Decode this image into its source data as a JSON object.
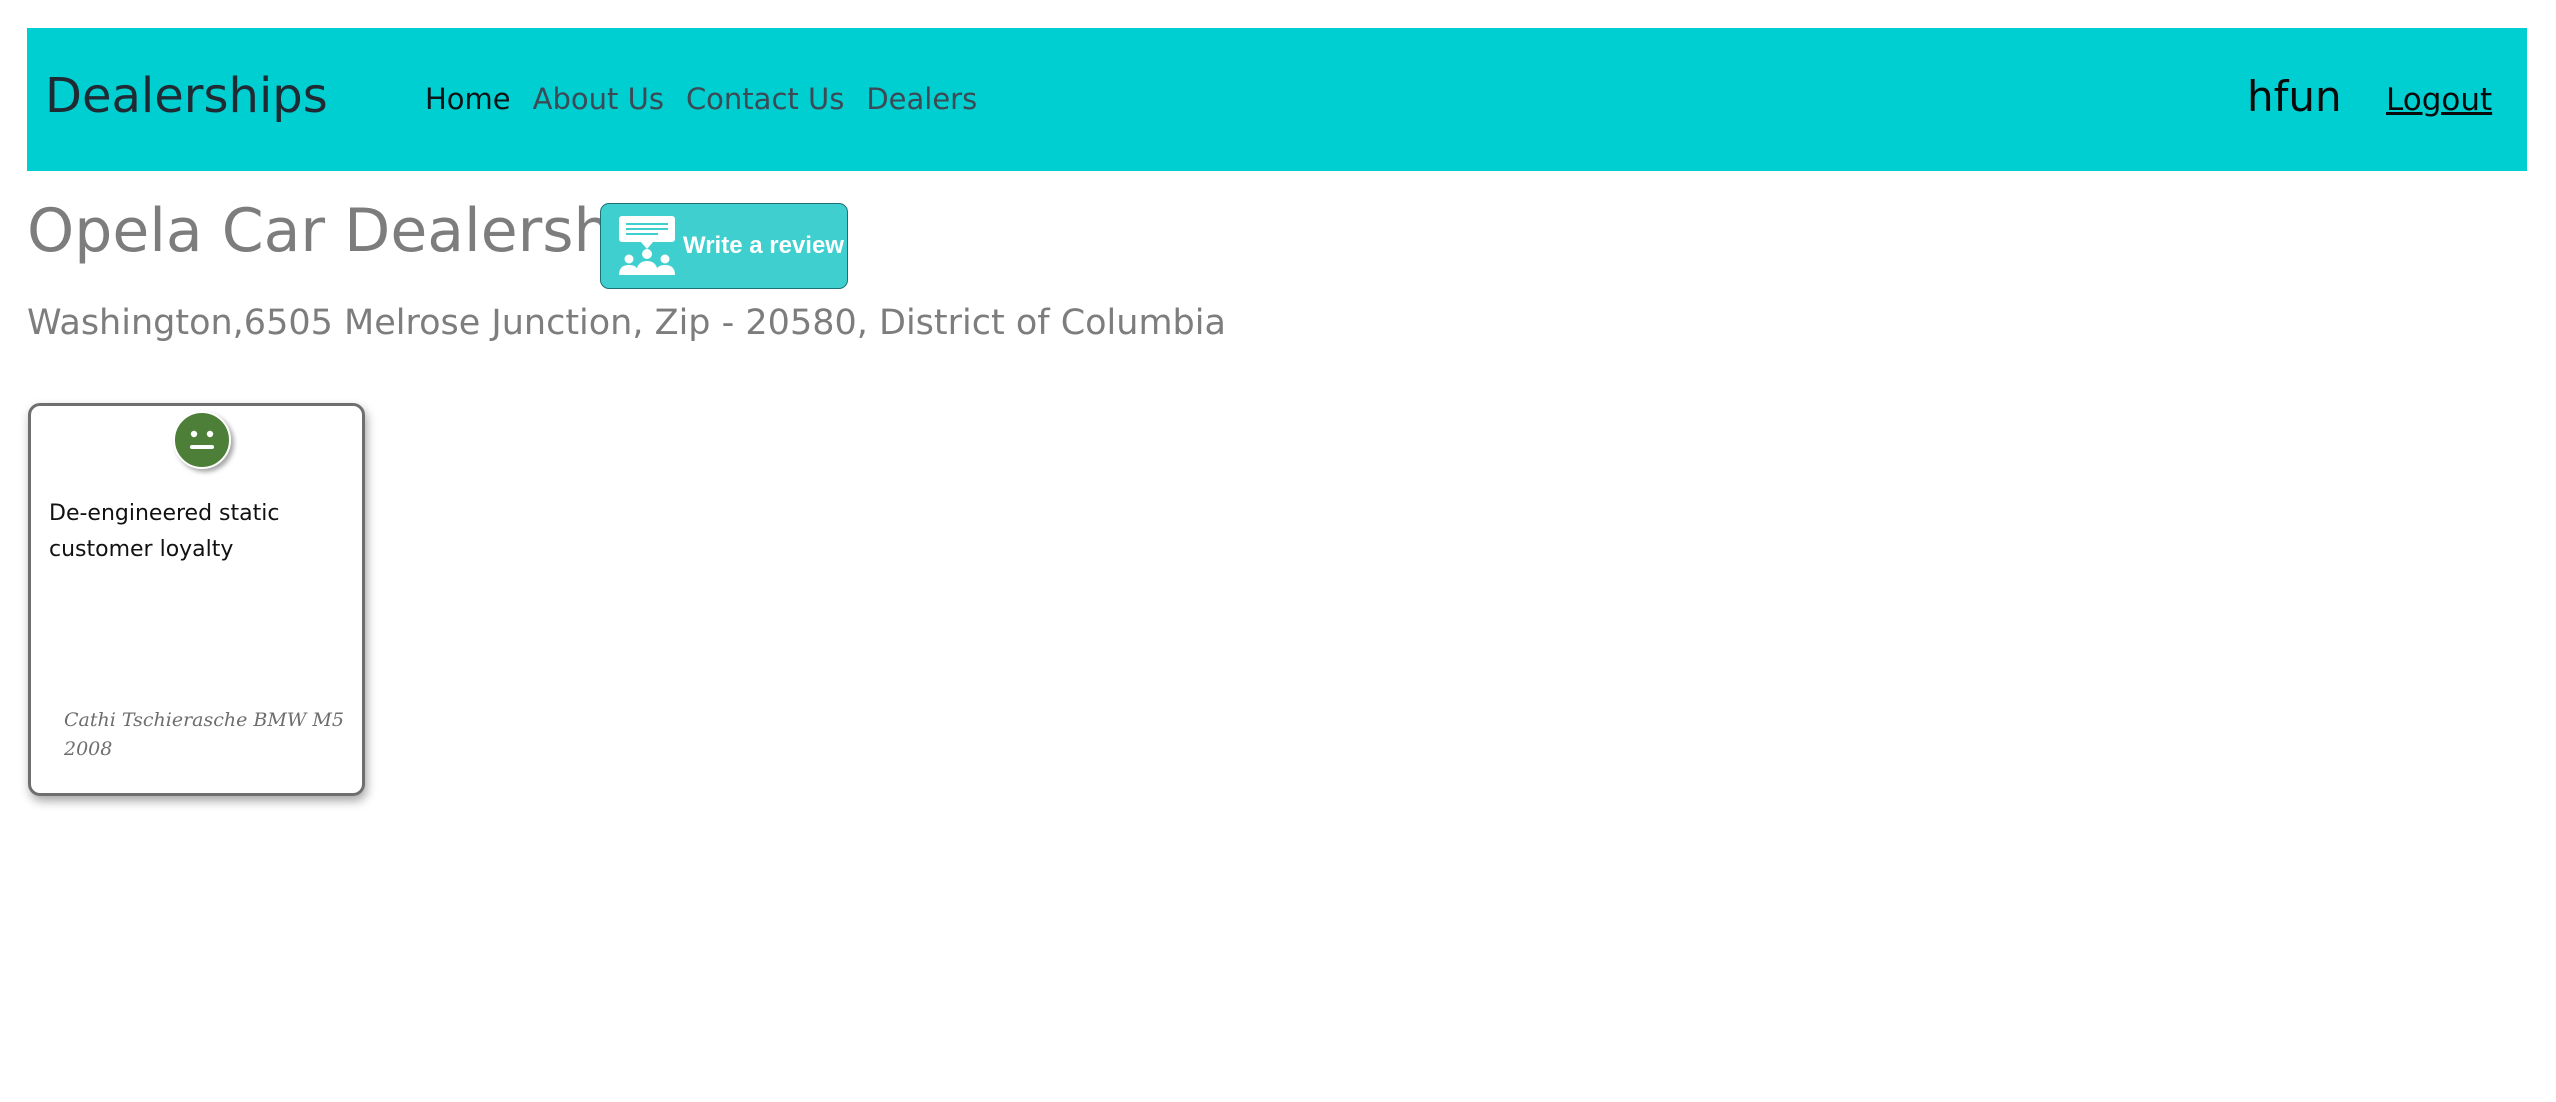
{
  "navbar": {
    "brand": "Dealerships",
    "links": [
      {
        "label": "Home"
      },
      {
        "label": "About Us"
      },
      {
        "label": "Contact Us"
      },
      {
        "label": "Dealers"
      }
    ],
    "username": "hfun",
    "logout_label": "Logout",
    "background_color": "#00cfd1"
  },
  "dealer": {
    "name": "Opela Car Dealership",
    "address": "Washington,6505 Melrose Junction, Zip - 20580, District of Columbia"
  },
  "write_review": {
    "label": "Write a review",
    "icon": "people-chat-icon",
    "color": "#3fcfcf"
  },
  "reviews": [
    {
      "sentiment_icon": "happy-face-icon",
      "sentiment_color": "#4e7f38",
      "text": "De-engineered static customer loyalty",
      "footer": "Cathi Tschierasche BMW M5 2008"
    }
  ]
}
